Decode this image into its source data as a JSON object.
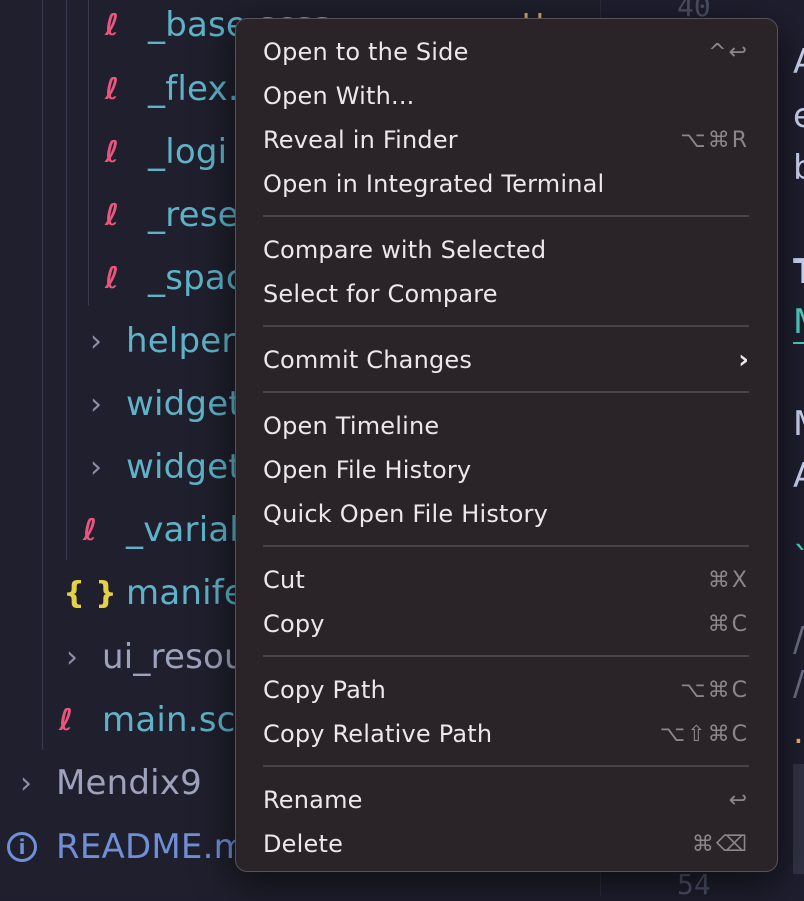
{
  "explorer": {
    "items": [
      {
        "label": "_base.scss",
        "icon": "sass-icon"
      },
      {
        "label": "_flex.",
        "icon": "sass-icon"
      },
      {
        "label": "_logi",
        "icon": "sass-icon"
      },
      {
        "label": "_rese",
        "icon": "sass-icon"
      },
      {
        "label": "_spac",
        "icon": "sass-icon"
      },
      {
        "label": "helpers",
        "icon": "chevron-right-icon"
      },
      {
        "label": "widget",
        "icon": "chevron-right-icon"
      },
      {
        "label": "widget",
        "icon": "chevron-right-icon"
      },
      {
        "label": "_variab",
        "icon": "sass-icon"
      },
      {
        "label": "manife",
        "icon": "json-icon"
      },
      {
        "label": "ui_resou",
        "icon": "chevron-right-icon"
      },
      {
        "label": "main.sc",
        "icon": "sass-icon"
      },
      {
        "label": "Mendix9",
        "icon": "chevron-right-icon"
      },
      {
        "label": "README.m",
        "icon": "info-icon"
      }
    ],
    "badge": "U"
  },
  "editor": {
    "line_top": "40",
    "line_bottom": "54",
    "fragments": [
      "A",
      "e",
      "b",
      "T",
      "M",
      "M",
      "A",
      "`",
      "/",
      "/",
      "."
    ]
  },
  "menu": {
    "items": [
      {
        "label": "Open to the Side",
        "shortcut": "^↩"
      },
      {
        "label": "Open With...",
        "shortcut": ""
      },
      {
        "label": "Reveal in Finder",
        "shortcut": "⌥⌘R"
      },
      {
        "label": "Open in Integrated Terminal",
        "shortcut": ""
      },
      {
        "label": "Compare with Selected",
        "shortcut": ""
      },
      {
        "label": "Select for Compare",
        "shortcut": ""
      },
      {
        "label": "Commit Changes",
        "shortcut": "",
        "submenu": true
      },
      {
        "label": "Open Timeline",
        "shortcut": ""
      },
      {
        "label": "Open File History",
        "shortcut": ""
      },
      {
        "label": "Quick Open File History",
        "shortcut": ""
      },
      {
        "label": "Cut",
        "shortcut": "⌘X"
      },
      {
        "label": "Copy",
        "shortcut": "⌘C"
      },
      {
        "label": "Copy Path",
        "shortcut": "⌥⌘C"
      },
      {
        "label": "Copy Relative Path",
        "shortcut": "⌥⇧⌘C"
      },
      {
        "label": "Rename",
        "shortcut": "↩"
      },
      {
        "label": "Delete",
        "shortcut": "⌘⌫"
      }
    ],
    "submenu_glyph": "›"
  }
}
